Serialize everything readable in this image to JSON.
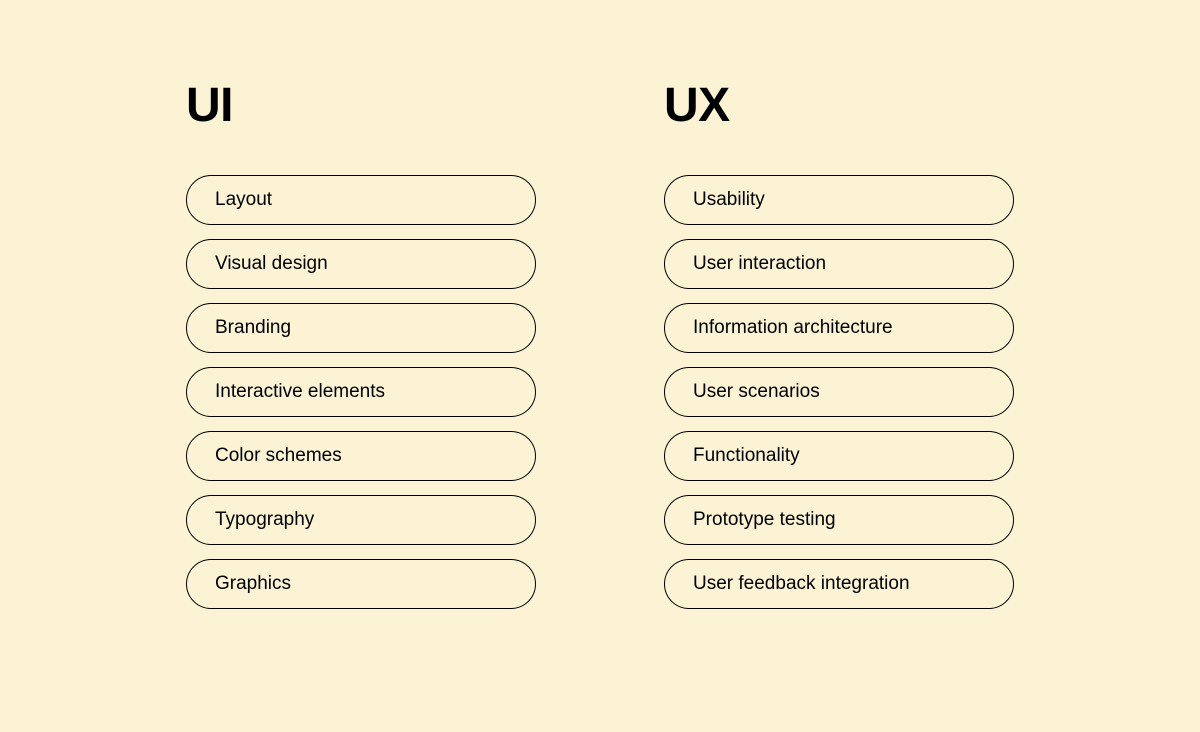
{
  "columns": [
    {
      "title": "UI",
      "items": [
        "Layout",
        "Visual design",
        "Branding",
        "Interactive elements",
        "Color schemes",
        "Typography",
        "Graphics"
      ]
    },
    {
      "title": "UX",
      "items": [
        "Usability",
        "User interaction",
        "Information architecture",
        "User scenarios",
        "Functionality",
        "Prototype testing",
        "User feedback integration"
      ]
    }
  ]
}
